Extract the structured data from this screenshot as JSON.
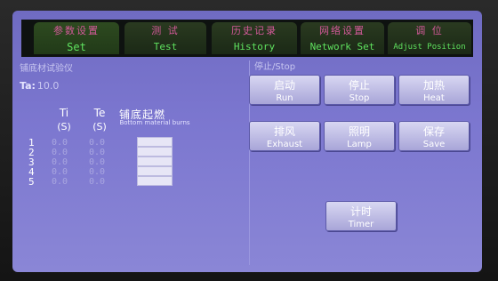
{
  "tabs": [
    {
      "cn": "参数设置",
      "en": "Set",
      "active": true
    },
    {
      "cn": "测 试",
      "en": "Test"
    },
    {
      "cn": "历史记录",
      "en": "History"
    },
    {
      "cn": "网络设置",
      "en": "Network Set"
    },
    {
      "cn": "调 位",
      "en": "Adjust Position"
    }
  ],
  "left_panel": {
    "title": "铺底材试验仪",
    "ta_label": "Ta:",
    "ta_value": "10.0",
    "columns": {
      "ti": "Ti",
      "ti_unit": "(S)",
      "te": "Te",
      "te_unit": "(S)",
      "bottom_cn": "铺底起燃",
      "bottom_en": "Bottom material burns"
    },
    "rows": [
      {
        "idx": "1",
        "ti": "0.0",
        "te": "0.0"
      },
      {
        "idx": "2",
        "ti": "0.0",
        "te": "0.0"
      },
      {
        "idx": "3",
        "ti": "0.0",
        "te": "0.0"
      },
      {
        "idx": "4",
        "ti": "0.0",
        "te": "0.0"
      },
      {
        "idx": "5",
        "ti": "0.0",
        "te": "0.0"
      }
    ]
  },
  "right_panel": {
    "status": "停止/Stop",
    "buttons": {
      "run": {
        "cn": "启动",
        "en": "Run"
      },
      "stop": {
        "cn": "停止",
        "en": "Stop"
      },
      "heat": {
        "cn": "加热",
        "en": "Heat"
      },
      "exhaust": {
        "cn": "排风",
        "en": "Exhaust"
      },
      "lamp": {
        "cn": "照明",
        "en": "Lamp"
      },
      "save": {
        "cn": "保存",
        "en": "Save"
      },
      "timer": {
        "cn": "计时",
        "en": "Timer"
      }
    }
  }
}
